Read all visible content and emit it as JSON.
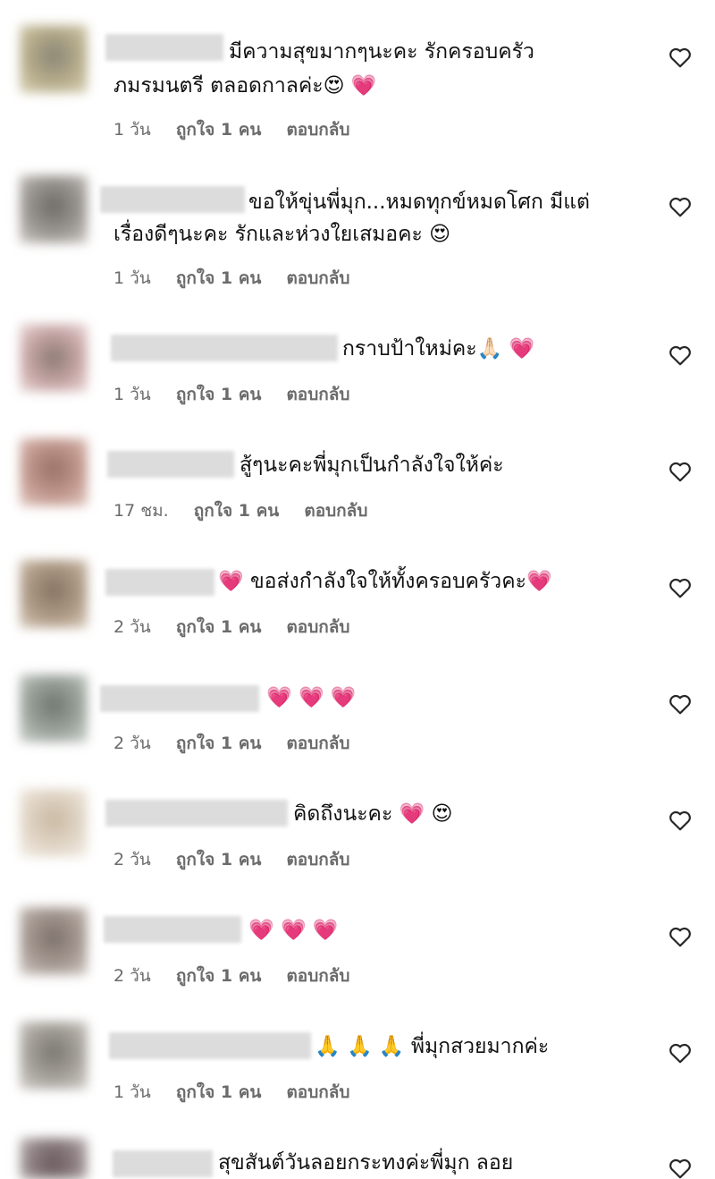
{
  "comments": [
    {
      "text1": "มีความสุขมากๆนะคะ รักครอบครัว",
      "text2": "ภมรมนตรี ตลอดกาลค่ะ😍 💗",
      "time": "1 วัน",
      "likes": "ถูกใจ 1 คน",
      "reply": "ตอบกลับ"
    },
    {
      "text1": "ขอให้ขุ่นพี่มุก...หมดทุกข์หมดโศก มีแต่",
      "text2": "เรื่องดีๆนะคะ รักและห่วงใยเสมอคะ 😍",
      "time": "1 วัน",
      "likes": "ถูกใจ 1 คน",
      "reply": "ตอบกลับ"
    },
    {
      "text1": "กราบป้าใหม่คะ🙏🏻 💗",
      "text2": "",
      "time": "1 วัน",
      "likes": "ถูกใจ 1 คน",
      "reply": "ตอบกลับ"
    },
    {
      "text1": "สู้ๆนะคะพี่มุกเป็นกำลังใจให้ค่ะ",
      "text2": "",
      "time": "17 ชม.",
      "likes": "ถูกใจ 1 คน",
      "reply": "ตอบกลับ"
    },
    {
      "text1": "💗 ขอส่งกำลังใจให้ทั้งครอบครัวคะ💗",
      "text2": "",
      "time": "2 วัน",
      "likes": "ถูกใจ 1 คน",
      "reply": "ตอบกลับ"
    },
    {
      "text1": "💗 💗 💗",
      "text2": "",
      "time": "2 วัน",
      "likes": "ถูกใจ 1 คน",
      "reply": "ตอบกลับ"
    },
    {
      "text1": "คิดถึงนะคะ 💗 😍",
      "text2": "",
      "time": "2 วัน",
      "likes": "ถูกใจ 1 คน",
      "reply": "ตอบกลับ"
    },
    {
      "text1": "💗 💗 💗",
      "text2": "",
      "time": "2 วัน",
      "likes": "ถูกใจ 1 คน",
      "reply": "ตอบกลับ"
    },
    {
      "text1": "🙏 🙏 🙏  พี่มุกสวยมากค่ะ",
      "text2": "",
      "time": "1 วัน",
      "likes": "ถูกใจ 1 คน",
      "reply": "ตอบกลับ"
    },
    {
      "text1": "สุขสันต์วันลอยกระทงค่ะพี่มุก ลอย",
      "text2": "",
      "time": "",
      "likes": "",
      "reply": ""
    }
  ]
}
